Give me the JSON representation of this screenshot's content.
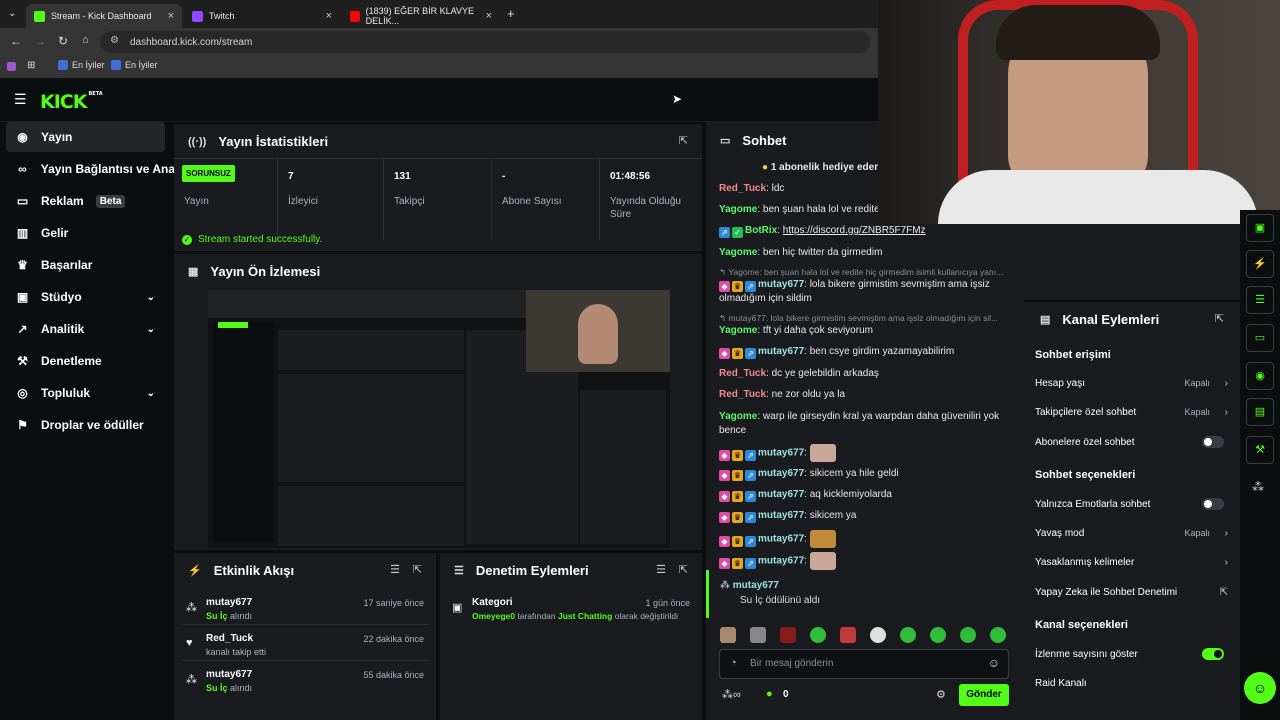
{
  "browser": {
    "tabs": [
      {
        "label": "Stream - Kick Dashboard"
      },
      {
        "label": "Twitch"
      },
      {
        "label": "(1839) EĞER BİR KLAVYE DELİK..."
      }
    ],
    "url": "dashboard.kick.com/stream",
    "bookmarks": [
      "En İyiler",
      "En İyiler"
    ]
  },
  "header": {
    "logo": "KICK",
    "logo_badge": "BETA"
  },
  "sidebar": {
    "items": [
      {
        "label": "Yayın",
        "icon": "broadcast-icon"
      },
      {
        "label": "Yayın Bağlantısı ve Anahtarı",
        "icon": "link-icon"
      },
      {
        "label": "Reklam",
        "icon": "ad-icon",
        "badge": "Beta"
      },
      {
        "label": "Gelir",
        "icon": "chart-icon"
      },
      {
        "label": "Başarılar",
        "icon": "trophy-icon"
      },
      {
        "label": "Stüdyo",
        "icon": "studio-icon"
      },
      {
        "label": "Analitik",
        "icon": "analytics-icon"
      },
      {
        "label": "Denetleme",
        "icon": "hammer-icon"
      },
      {
        "label": "Topluluk",
        "icon": "community-icon"
      },
      {
        "label": "Droplar ve ödüller",
        "icon": "gift-icon"
      }
    ]
  },
  "stats": {
    "title": "Yayın İstatistikleri",
    "status_badge": "SORUNSUZ",
    "cells": [
      {
        "value": "",
        "label": "Yayın"
      },
      {
        "value": "7",
        "label": "İzleyici"
      },
      {
        "value": "131",
        "label": "Takipçi"
      },
      {
        "value": "-",
        "label": "Abone Sayısı"
      },
      {
        "value": "01:48:56",
        "label": "Yayında Olduğu Süre"
      }
    ],
    "success": "Stream started successfully."
  },
  "preview": {
    "title": "Yayın Ön İzlemesi"
  },
  "activity": {
    "title": "Etkinlik Akışı",
    "rows": [
      {
        "name": "mutay677",
        "detail_prefix": "",
        "detail_strong": "Su İç",
        "detail_suffix": " alındı",
        "time": "17 saniye önce",
        "icon": "points-icon"
      },
      {
        "name": "Red_Tuck",
        "detail_prefix": "kanalı takip etti",
        "detail_strong": "",
        "detail_suffix": "",
        "time": "22 dakika önce",
        "icon": "heart-icon"
      },
      {
        "name": "mutay677",
        "detail_prefix": "",
        "detail_strong": "Su İç",
        "detail_suffix": " alındı",
        "time": "55 dakika önce",
        "icon": "points-icon"
      }
    ]
  },
  "moderation": {
    "title": "Denetim Eylemleri",
    "rows": [
      {
        "title": "Kategori",
        "user": "Omeyege0",
        "mid": " tarafından ",
        "cat": "Just Chatting",
        "tail": " olarak değiştirildi",
        "time": "1 gün önce"
      }
    ]
  },
  "chat": {
    "title": "Sohbet",
    "pinned": "1 abonelik hediye eder",
    "messages": [
      {
        "user": "Red_Tuck",
        "text": "ldc"
      },
      {
        "user": "Yagome",
        "text": "ben şuan hala lol ve redite"
      },
      {
        "user": "BotRix",
        "text": "https://discord.gg/ZNBR5F7FMz"
      },
      {
        "user": "Yagome",
        "text": "ben hiç twitter da girmedim"
      },
      {
        "reply": "Yagome: ben şuan hala lol ve redite hiç girmedim isimli kullanıcıya yanı..."
      },
      {
        "user": "mutay677",
        "text": "lola bikere girmistim sevmiştim ama işsiz olmadığım için sildim"
      },
      {
        "reply": "mutay677: lola bikere girmistim sevmiştim ama işsiz olmadığım için sil..."
      },
      {
        "user": "Yagome",
        "text": "tft yi daha çok seviyorum"
      },
      {
        "user": "mutay677",
        "text": "ben csye girdim yazamayabilirim"
      },
      {
        "user": "Red_Tuck",
        "text": "dc ye gelebildin arkadaş"
      },
      {
        "user": "Red_Tuck",
        "text": "ne zor oldu ya la"
      },
      {
        "user": "Yagome",
        "text": "warp ile girseydin kral ya warpdan daha güveniliri yok bence"
      },
      {
        "user": "mutay677",
        "text": ""
      },
      {
        "user": "mutay677",
        "text": "sikicem ya hile geldi"
      },
      {
        "user": "mutay677",
        "text": "aq kicklemiyolarda"
      },
      {
        "user": "mutay677",
        "text": "sikicem ya"
      },
      {
        "user": "mutay677",
        "text": ""
      },
      {
        "user": "mutay677",
        "text": ""
      }
    ],
    "reward": {
      "user": "mutay677",
      "text": "Su İç ödülünü aldı"
    },
    "input_placeholder": "Bir mesaj gönderin",
    "points": "0",
    "send": "Gönder"
  },
  "channel": {
    "title": "Kanal Eylemleri",
    "sections": [
      {
        "heading": "Sohbet erişimi"
      },
      {
        "heading": "Sohbet seçenekleri"
      },
      {
        "heading": "Kanal seçenekleri"
      }
    ],
    "rows": [
      {
        "label": "Hesap yaşı",
        "value": "Kapalı"
      },
      {
        "label": "Takipçilere özel sohbet",
        "value": "Kapalı"
      },
      {
        "label": "Abonelere özel sohbet",
        "value": ""
      },
      {
        "label": "Yalnızca Emotlarla sohbet",
        "value": ""
      },
      {
        "label": "Yavaş mod",
        "value": "Kapalı"
      },
      {
        "label": "Yasaklanmış kelimeler",
        "value": ""
      },
      {
        "label": "Yapay Zeka ile Sohbet Denetimi",
        "value": ""
      },
      {
        "label": "İzlenme sayısını göster",
        "value": ""
      },
      {
        "label": "Raid Kanalı",
        "value": ""
      }
    ]
  },
  "colors": {
    "accent": "#53fc18",
    "panel": "#191b1f",
    "bg": "#0b0e0f"
  }
}
